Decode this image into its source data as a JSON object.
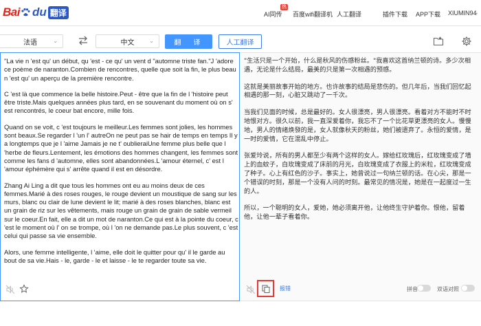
{
  "nav": {
    "logo_red": "Bai",
    "logo_blue": "du",
    "logo_badge": "翻译",
    "ai_badge": "热",
    "links": [
      "AI同传",
      "百度wifi翻译机",
      "人工翻译",
      "插件下载",
      "APP下载",
      "XIUMIN94"
    ]
  },
  "toolbar": {
    "source_lang": "法语",
    "target_lang": "中文",
    "translate_label": "翻　译",
    "human_label": "人工翻译"
  },
  "source": {
    "paragraphs": [
      "\"La vie n 'est qu' un début, qu 'est - ce qu' un vent d \"automne triste fan.\"J 'adore ce poème de naranton.Combien de rencontres, quelle que soit la fin, le plus beau n 'est qu' un aperçu de la première rencontre.",
      "C 'est là que commence la belle histoire.Peut - être que la fin de l 'histoire peut être triste.Mais quelques années plus tard, en se souvenant du moment où on s' est rencontrés, le coeur bat encore, mille fois.",
      "Quand on se voit, c 'est toujours le meilleur.Les femmes sont jolies, les hommes sont beaux.Se regarder l 'un l' autreOn ne peut pas se hair de temps en temps Il y a longtemps que je l 'aime Jamais je ne t' oublieraiUne femme plus belle que l 'herbe de fleurs.Lentement, les émotions des hommes changent, les femmes sont comme les fans d 'automne, elles sont abandonnées.L 'amour éternel, c' est l 'amour éphémère qui s' arrête quand il est en désordre.",
      "Zhang Ai Ling a dit que tous les hommes ont eu au moins deux de ces femmes.Marié à des roses rouges, le rouge devient un moustique de sang sur les murs, blanc ou clair de lune devient le lit; marié à des roses blanches, blanc est un grain de riz sur les vêtements, mais rouge un grain de grain de sable vermeil sur le coeur.En fait, elle a dit un mot de naranton.Ce qui est à la pointe du coeur, c 'est le moment où l' on se trompe, où l 'on ne demande pas.Le plus souvent, c 'est celui qui passe sa vie ensemble.",
      "Alors, une femme intelligente, l 'aime, elle doit le quitter pour qu' il le garde au bout de sa vie.Hais - le, garde - le et laisse - le te regarder toute sa vie."
    ]
  },
  "target": {
    "paragraphs": [
      "\"生活只是一个开始，什么是秋风的伤感粉丝。\"我喜欢这首纳兰顿的诗。多少次相遇，无论是什么结局，最美的只是第一次相遇的预感。",
      "这就是美丽故事开始的地方。也许故事的结局是悲伤的。但几年后，当我们回忆起相遇的那一刻，心脏又跳动了一千次。",
      "当我们见面的时候，总是最好的。女人很漂亮，男人很漂亮。看着对方不能时不时地恨对方。很久以前，我一直深爱着你，我忘不了一个比花草更漂亮的女人。慢慢地，男人的情绪焕發的是，女人就像秋天的粉丝，她们被遗弃了。永恒的爱情，是一时的爱情，它在混乱中停止。",
      "张爱玲说，所有的男人都至少有两个这样的女人。嫁给红玫瑰后，红玫瑰变成了墙上的血蚊子，白玫瑰变成了床前的月光，白玫瑰变成了衣服上的米粒，红玫瑰变成了种子。心上有红色的沙子。事实上，她曾说过一句纳兰顿的话。在心尖，那是一个错误的时刻，那是一个没有人问的时刻。最常见的情况是，她是在一起度过一生的人。",
      "所以，一个聪明的女人，爱她，她必须离开他，让他终生守护着你。恨他，留着他，让他一辈子看着你。"
    ],
    "feedback_label": "报错",
    "pinyin_label": "拼音",
    "bilingual_label": "双语对照"
  },
  "colors": {
    "accent": "#4395ff",
    "link": "#3b7bea",
    "highlight": "#e53935"
  }
}
